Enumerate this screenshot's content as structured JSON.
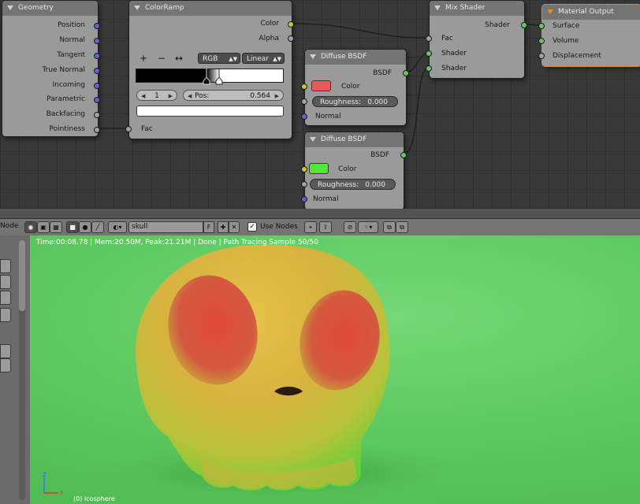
{
  "nodes": {
    "geometry": {
      "title": "Geometry",
      "outputs": [
        "Position",
        "Normal",
        "Tangent",
        "True Normal",
        "Incoming",
        "Parametric",
        "Backfacing",
        "Pointiness"
      ]
    },
    "colorramp": {
      "title": "ColorRamp",
      "outputs": [
        "Color",
        "Alpha"
      ],
      "input": "Fac",
      "toolbar": {
        "add": "+",
        "remove": "−",
        "flip": "↔"
      },
      "color_mode": "RGB",
      "interpolation": "Linear",
      "active_index": "1",
      "pos_label": "Pos:",
      "pos_value": "0.564",
      "ramp_stop_position": 0.564,
      "selected_color": "#ffffff"
    },
    "mix_shader": {
      "title": "Mix Shader",
      "output": "Shader",
      "inputs": [
        "Fac",
        "Shader",
        "Shader"
      ]
    },
    "material_output": {
      "title": "Material Output",
      "inputs": [
        "Surface",
        "Volume",
        "Displacement"
      ]
    },
    "diffuse_1": {
      "title": "Diffuse BSDF",
      "output": "BSDF",
      "color_label": "Color",
      "color": "#e55a5a",
      "roughness_label": "Roughness:",
      "roughness": "0.000",
      "normal_label": "Normal"
    },
    "diffuse_2": {
      "title": "Diffuse BSDF",
      "output": "BSDF",
      "color_label": "Color",
      "color": "#4fe83a",
      "roughness_label": "Roughness:",
      "roughness": "0.000",
      "normal_label": "Normal"
    }
  },
  "header": {
    "menu_node": "Node",
    "material_name": "skull",
    "fake_user": "F",
    "use_nodes_label": "Use Nodes",
    "use_nodes_checked": "✓"
  },
  "viewport": {
    "status": "Time:00:08.78 | Mem:20.50M, Peak:21.21M | Done | Path Tracing Sample 50/50",
    "object_label": "(0) Icosphere",
    "axis_z": "Z",
    "axis_x": "X"
  },
  "colors": {
    "socket_blue": "#6363c7",
    "socket_gray": "#a1a1a1",
    "socket_yellow": "#c7c729",
    "socket_green": "#63c763",
    "output_node_accent": "#e58a2a",
    "background_green": "#5fca61"
  }
}
